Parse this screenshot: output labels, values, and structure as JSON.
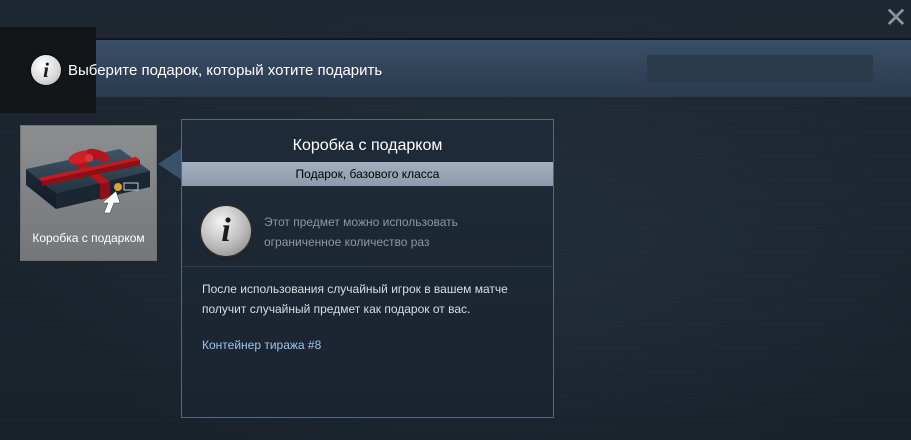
{
  "window": {
    "close_label": "✕"
  },
  "header": {
    "info_icon_glyph": "i",
    "title": "Выберите подарок, который хотите подарить"
  },
  "item_card": {
    "label": "Коробка с подарком",
    "image": "gift-box-image"
  },
  "tooltip": {
    "title": "Коробка с подарком",
    "rarity": "Подарок, базового класса",
    "info_icon_glyph": "i",
    "usage_note": [
      "Этот предмет можно использовать",
      "ограниченное количество раз"
    ],
    "description": [
      "После использования случайный игрок в вашем матче",
      "получит случайный предмет как подарок от вас."
    ],
    "collection": "Контейнер тиража #8"
  },
  "colors": {
    "header_bar": "#34495f",
    "tooltip_border": "#52697f",
    "rarity_bar": "#9aa8b7",
    "link": "#9cc4ea"
  }
}
